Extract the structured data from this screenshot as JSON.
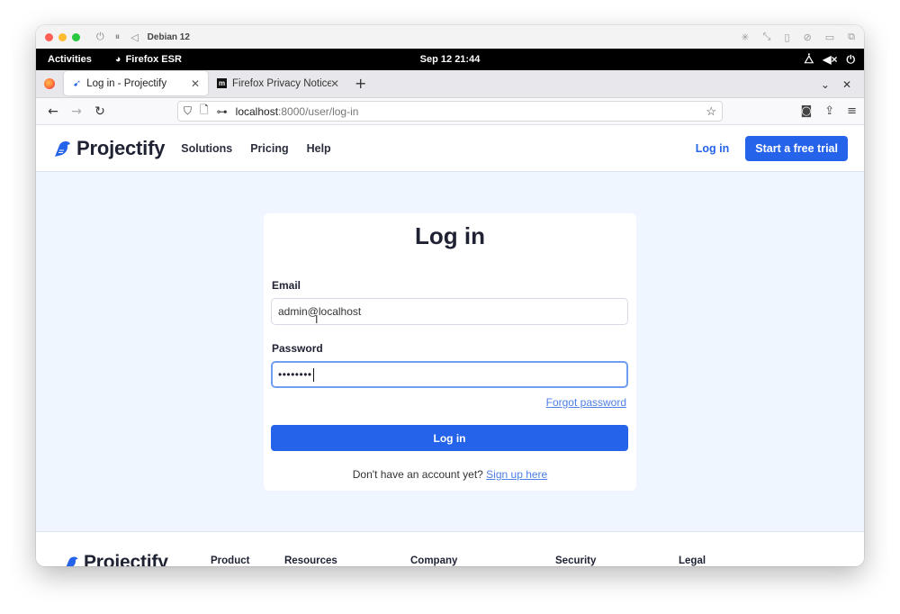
{
  "vm": {
    "title": "Debian 12",
    "controls": [
      "power-icon",
      "pause-icon",
      "back-icon"
    ],
    "right_icons": [
      "brightness-icon",
      "resize-icon",
      "usb-icon",
      "block-icon",
      "folder-icon",
      "window-icon"
    ]
  },
  "gnome": {
    "activities": "Activities",
    "app_name": "Firefox ESR",
    "clock": "Sep 12  21:44",
    "tray_icons": [
      "network-icon",
      "volume-muted-icon",
      "power-icon"
    ]
  },
  "browser": {
    "tabs": [
      {
        "title": "Log in - Projectify",
        "active": true
      },
      {
        "title": "Firefox Privacy Notice — ",
        "active": false
      }
    ],
    "new_tab": "+",
    "url_host": "localhost",
    "url_rest": ":8000/user/log-in"
  },
  "site": {
    "brand": "Projectify",
    "nav": [
      "Solutions",
      "Pricing",
      "Help"
    ],
    "header_login": "Log in",
    "trial_button": "Start a free trial"
  },
  "login": {
    "title": "Log in",
    "email_label": "Email",
    "email_value": "admin@localhost",
    "password_label": "Password",
    "password_mask": "••••••••",
    "forgot": "Forgot password",
    "submit": "Log in",
    "signup_prompt": "Don't have an account yet?",
    "signup_link": "Sign up here"
  },
  "footer": {
    "brand": "Projectify",
    "columns": [
      "Product",
      "Resources",
      "Company",
      "Security",
      "Legal"
    ]
  },
  "colors": {
    "primary": "#2563eb",
    "page_bg": "#eff6ff",
    "link": "#4d7fe6"
  }
}
